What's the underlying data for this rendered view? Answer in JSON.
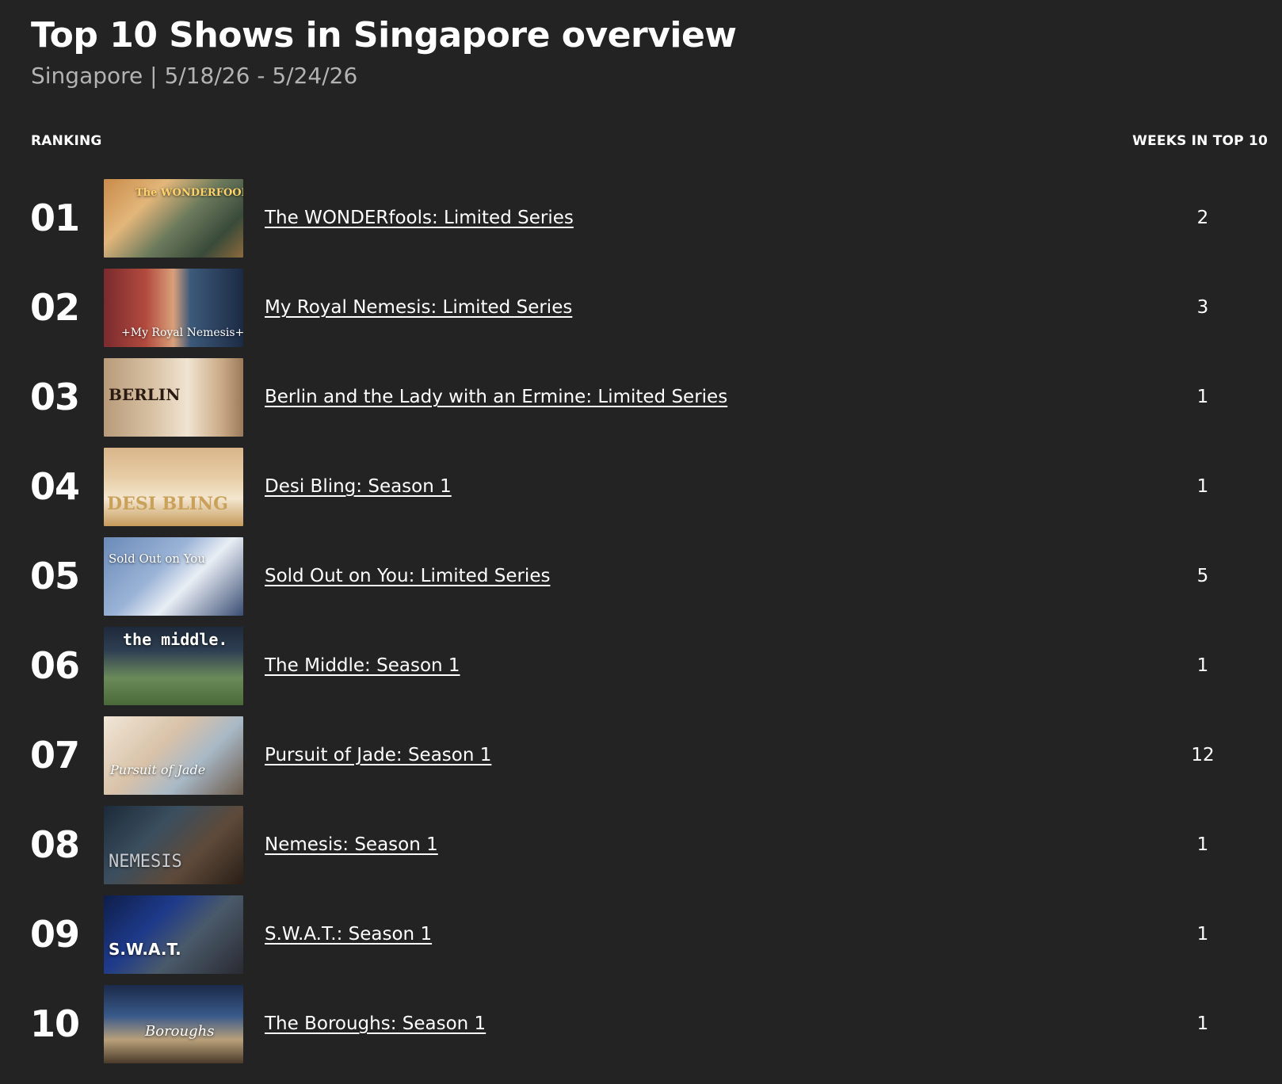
{
  "header": {
    "title": "Top 10 Shows in Singapore overview",
    "subtitle": "Singapore | 5/18/26 - 5/24/26"
  },
  "columns": {
    "ranking": "RANKING",
    "weeks": "WEEKS IN TOP 10"
  },
  "shows": [
    {
      "rank": "01",
      "title": "The WONDERfools: Limited Series",
      "weeks": "2",
      "thumb_text": "The WONDERFOOLS"
    },
    {
      "rank": "02",
      "title": "My Royal Nemesis: Limited Series",
      "weeks": "3",
      "thumb_text": "+My Royal Nemesis+"
    },
    {
      "rank": "03",
      "title": "Berlin and the Lady with an Ermine: Limited Series",
      "weeks": "1",
      "thumb_text": "BERLIN"
    },
    {
      "rank": "04",
      "title": "Desi Bling: Season 1",
      "weeks": "1",
      "thumb_text": "DESI BLING"
    },
    {
      "rank": "05",
      "title": "Sold Out on You: Limited Series",
      "weeks": "5",
      "thumb_text": "Sold Out on You"
    },
    {
      "rank": "06",
      "title": "The Middle: Season 1",
      "weeks": "1",
      "thumb_text": "the middle."
    },
    {
      "rank": "07",
      "title": "Pursuit of Jade: Season 1",
      "weeks": "12",
      "thumb_text": "Pursuit of Jade"
    },
    {
      "rank": "08",
      "title": "Nemesis: Season 1",
      "weeks": "1",
      "thumb_text": "NEMESIS"
    },
    {
      "rank": "09",
      "title": "S.W.A.T.: Season 1",
      "weeks": "1",
      "thumb_text": "S.W.A.T."
    },
    {
      "rank": "10",
      "title": "The Boroughs: Season 1",
      "weeks": "1",
      "thumb_text": "Boroughs"
    }
  ]
}
